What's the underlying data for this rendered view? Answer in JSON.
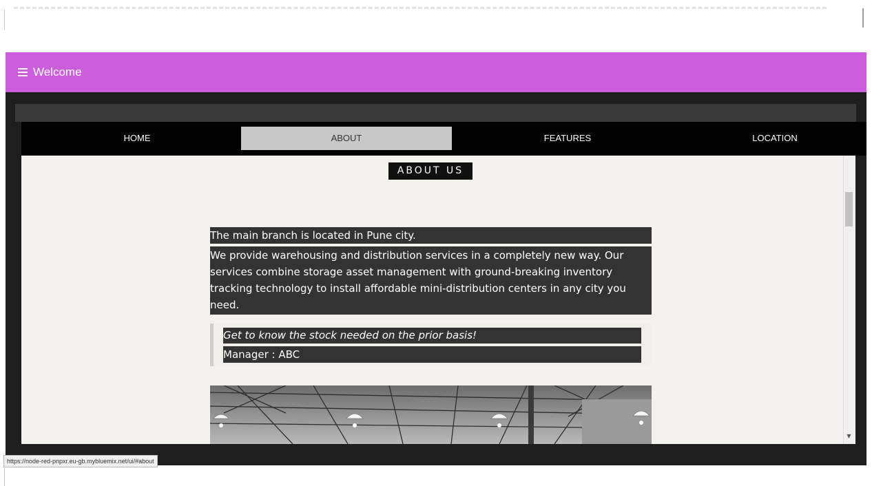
{
  "header": {
    "title": "Welcome",
    "menu_icon": "hamburger-menu-icon"
  },
  "nav": {
    "items": [
      {
        "label": "HOME"
      },
      {
        "label": "ABOUT",
        "active": true
      },
      {
        "label": "FEATURES"
      },
      {
        "label": "LOCATION"
      }
    ]
  },
  "about": {
    "heading": "ABOUT US",
    "location_line": "The main branch is located in Pune city.",
    "description_lines": [
      "We provide warehousing and distribution services in a completely new way. Our",
      "services combine storage asset management with ground-breaking inventory",
      "tracking technology to install affordable mini-distribution centers in any city you",
      "need."
    ],
    "quote": "Get to know the stock needed on the prior basis!",
    "quote_author": "Manager : ABC"
  },
  "status_bar": {
    "url": "https://node-red-pnpxr.eu-gb.mybluemix.net/ui/#about"
  },
  "colors": {
    "header_bg": "#cc5ddd",
    "nav_bg": "#000000",
    "nav_active_bg": "#c8c8c8",
    "content_bg": "#f4f2ee",
    "text_box_bg": "#333333"
  }
}
